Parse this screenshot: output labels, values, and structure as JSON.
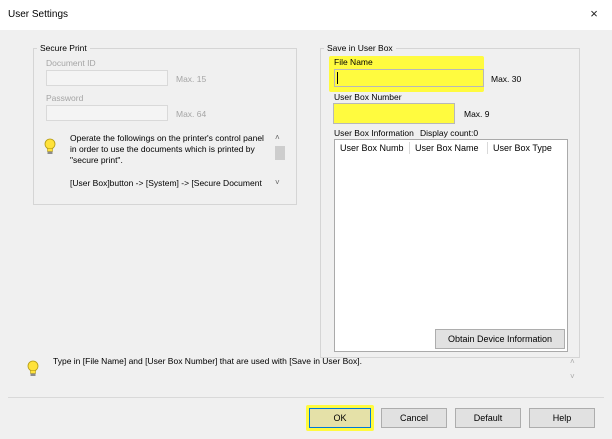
{
  "window": {
    "title": "User Settings",
    "close_symbol": "×"
  },
  "secure_print": {
    "legend": "Secure Print",
    "document_id_label": "Document ID",
    "document_id_value": "",
    "document_id_max": "Max. 15",
    "password_label": "Password",
    "password_value": "",
    "password_max": "Max. 64",
    "info_line1": "Operate the followings on the printer's control panel",
    "info_line2": "in order to use the documents which is printed by",
    "info_line3": "\"secure print\".",
    "info_line4": "[User Box]button -> [System] -> [Secure Document"
  },
  "save_in_user_box": {
    "legend": "Save in User Box",
    "file_name_label": "File Name",
    "file_name_value": "",
    "file_name_max": "Max. 30",
    "user_box_number_label": "User Box Number",
    "user_box_number_value": "",
    "user_box_number_max": "Max. 9",
    "user_box_info_label": "User Box Information",
    "display_count_label": "Display count:0",
    "columns": [
      "User Box Numb",
      "User Box Name",
      "User Box Type"
    ],
    "obtain_button": "Obtain Device Information"
  },
  "hint_text": "Type in [File Name] and [User Box Number] that are used with [Save in User Box].",
  "buttons": {
    "ok": "OK",
    "cancel": "Cancel",
    "default": "Default",
    "help": "Help"
  },
  "colors": {
    "highlight": "#fffb3f",
    "dialog_bg": "#f0f0f0",
    "focus_border": "#0078d7"
  },
  "icons": {
    "info": "lightbulb-icon",
    "close": "close-icon"
  }
}
